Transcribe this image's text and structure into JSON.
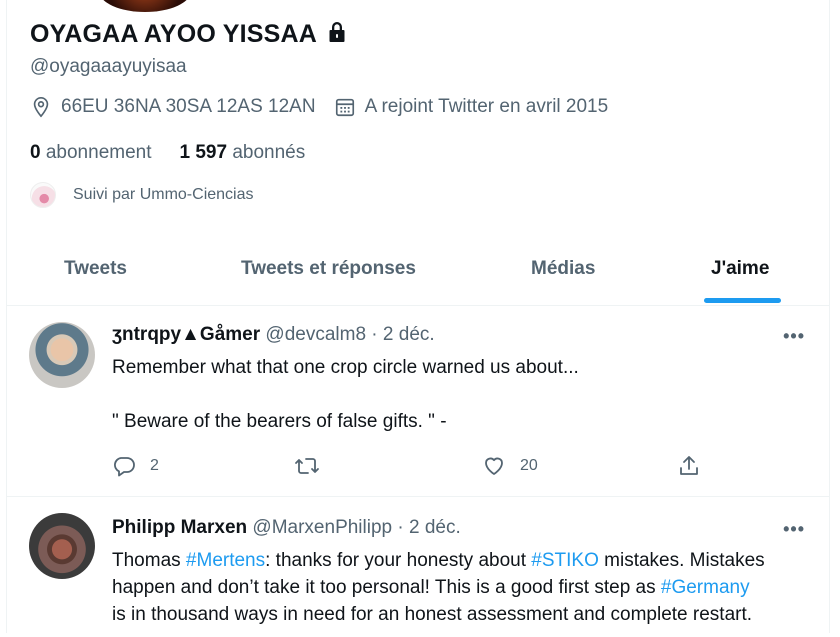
{
  "profile": {
    "name": "OYAGAA AYOO YISSAA",
    "handle": "@oyagaaayuyisaa",
    "location": "66EU 36NA 30SA 12AS 12AN",
    "joined": "A rejoint Twitter en avril 2015",
    "following_count": "0",
    "following_label": "abonnement",
    "followers_count": "1 597",
    "followers_label": "abonnés",
    "followed_by": "Suivi par Ummo-Ciencias"
  },
  "tabs": [
    {
      "label": "Tweets"
    },
    {
      "label": "Tweets et réponses"
    },
    {
      "label": "Médias"
    },
    {
      "label": "J'aime",
      "active": true
    }
  ],
  "tweets": [
    {
      "display_name": "ʒntrqpy▲Gåmer",
      "username": "@devcalm8",
      "date": "· 2 déc.",
      "line1": "Remember what that one crop circle warned us about...",
      "line2": "\" Beware of the bearers of false gifts. \" -",
      "replies": "2",
      "retweets": "",
      "likes": "20"
    },
    {
      "display_name": "Philipp Marxen",
      "username": "@MarxenPhilipp",
      "date": "· 2 déc.",
      "t1": "Thomas ",
      "h1": "#Mertens",
      "t2": ": thanks for your honesty about ",
      "h2": "#STIKO",
      "t3": " mistakes. Mistakes",
      "t4": "happen and don’t take it too personal! This is a good first step as ",
      "h3": "#Germany",
      "t5": "is in thousand ways in need for an honest assessment and complete restart."
    }
  ],
  "more_label": "•••",
  "colors": {
    "accent": "#1d9bf0",
    "secondary_text": "#536471",
    "primary_text": "#0f1419"
  }
}
